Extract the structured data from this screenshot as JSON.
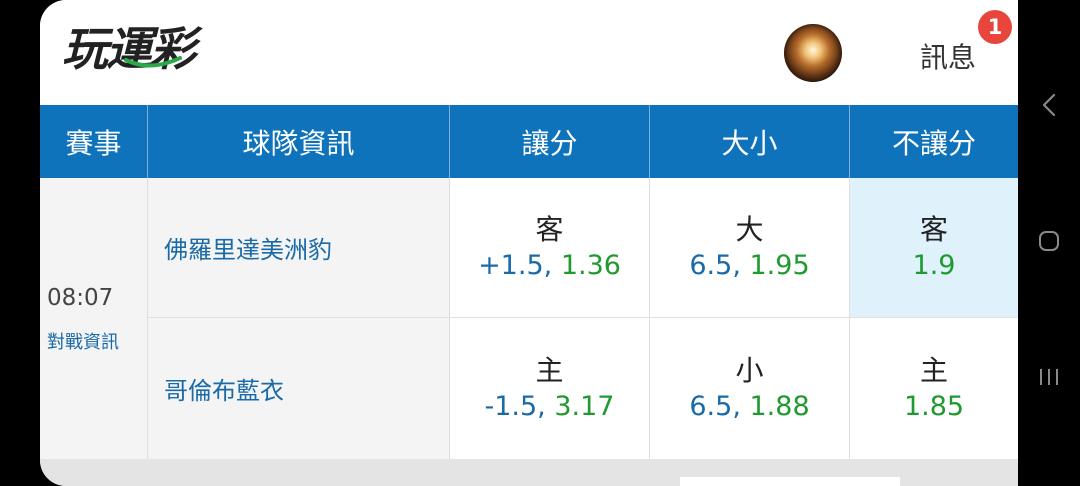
{
  "header": {
    "logo_text": "玩運彩",
    "messages_label": "訊息",
    "messages_badge": "1"
  },
  "table": {
    "columns": [
      "賽事",
      "球隊資訊",
      "讓分",
      "大小",
      "不讓分"
    ],
    "event": {
      "time": "08:07",
      "link": "對戰資訊"
    },
    "rows": [
      {
        "team": "佛羅里達美洲豹",
        "handicap": {
          "side": "客",
          "point": "+1.5,",
          "price": "1.36"
        },
        "over_under": {
          "side": "大",
          "point": "6.5,",
          "price": "1.95"
        },
        "moneyline": {
          "side": "客",
          "price": "1.9",
          "selected": true
        }
      },
      {
        "team": "哥倫布藍衣",
        "handicap": {
          "side": "主",
          "point": "-1.5,",
          "price": "3.17"
        },
        "over_under": {
          "side": "小",
          "point": "6.5,",
          "price": "1.88"
        },
        "moneyline": {
          "side": "主",
          "price": "1.85",
          "selected": false
        }
      }
    ]
  },
  "nav": {
    "icons": [
      "back-icon",
      "home-icon",
      "recent-apps-icon"
    ]
  },
  "colors": {
    "header_blue": "#0f73bb",
    "point_blue": "#1a6aa8",
    "price_green": "#1f9a2f",
    "badge_red": "#e8463c",
    "selected_bg": "#dff1fb"
  }
}
